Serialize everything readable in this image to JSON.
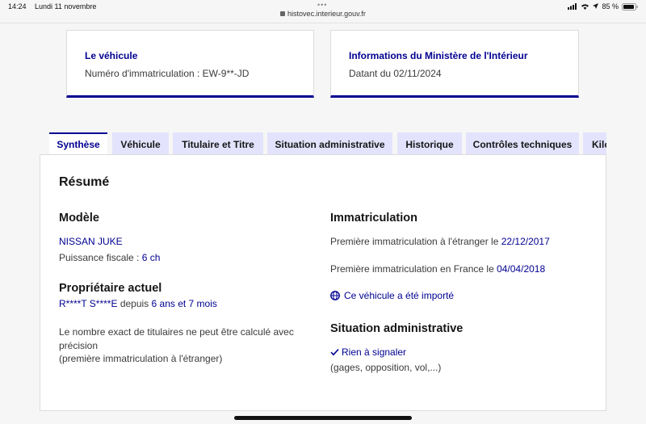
{
  "status_bar": {
    "time": "14:24",
    "date": "Lundi 11 novembre",
    "battery": "85 %"
  },
  "browser": {
    "url": "histovec.interieur.gouv.fr"
  },
  "cards": {
    "vehicle": {
      "title": "Le véhicule",
      "plate_text": "Numéro d'immatriculation : EW-9**-JD"
    },
    "ministry": {
      "title": "Informations du Ministère de l'Intérieur",
      "date_text": "Datant du 02/11/2024"
    }
  },
  "tabs": [
    {
      "label": "Synthèse",
      "active": true
    },
    {
      "label": "Véhicule",
      "active": false
    },
    {
      "label": "Titulaire et Titre",
      "active": false
    },
    {
      "label": "Situation administrative",
      "active": false
    },
    {
      "label": "Historique",
      "active": false
    },
    {
      "label": "Contrôles techniques",
      "active": false
    },
    {
      "label": "Kilo",
      "active": false
    }
  ],
  "summary": {
    "title": "Résumé",
    "model": {
      "heading": "Modèle",
      "name": "NISSAN JUKE",
      "fiscal_label": "Puissance fiscale : ",
      "fiscal_value": "6 ch"
    },
    "owner": {
      "heading": "Propriétaire actuel",
      "name": "R****T S****E",
      "since_label": " depuis ",
      "since_value": "6 ans et 7 mois",
      "note_line1": "Le nombre exact de titulaires ne peut être calculé avec",
      "note_line2": "précision",
      "note_line3": "(première immatriculation à l'étranger)"
    },
    "registration": {
      "heading": "Immatriculation",
      "foreign_label": "Première immatriculation à l'étranger le ",
      "foreign_date": "22/12/2017",
      "france_label": "Première immatriculation en France le ",
      "france_date": "04/04/2018",
      "imported_label": "Ce véhicule a été importé"
    },
    "admin": {
      "heading": "Situation administrative",
      "status": "Rien à signaler",
      "details": "(gages, opposition, vol,...)"
    }
  },
  "colors": {
    "accent": "#000091",
    "tab_bg": "#e3e3fd",
    "page_bg": "#f6f6f6"
  }
}
